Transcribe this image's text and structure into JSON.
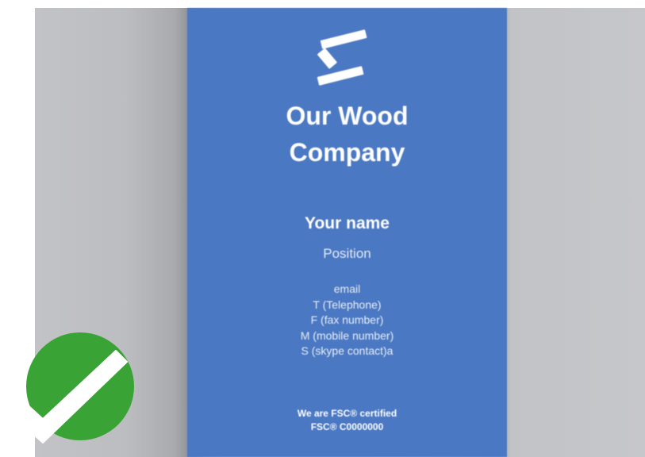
{
  "card": {
    "company_line1": "Our Wood",
    "company_line2": "Company",
    "name": "Your name",
    "position": "Position",
    "contacts": [
      "email",
      "T (Telephone)",
      "F (fax number)",
      "M (mobile number)",
      "S (skype contact)a"
    ],
    "fsc_line1": "We are FSC® certified",
    "fsc_line2": "FSC® C0000000",
    "background_color": "#4a78c2",
    "text_color": "#ffffff"
  },
  "logo": {
    "icon": "logo-stripes-icon"
  },
  "badge": {
    "icon": "checkmark-icon",
    "color": "#3aa335"
  },
  "backdrop": {
    "color": "#c2c3c6"
  }
}
